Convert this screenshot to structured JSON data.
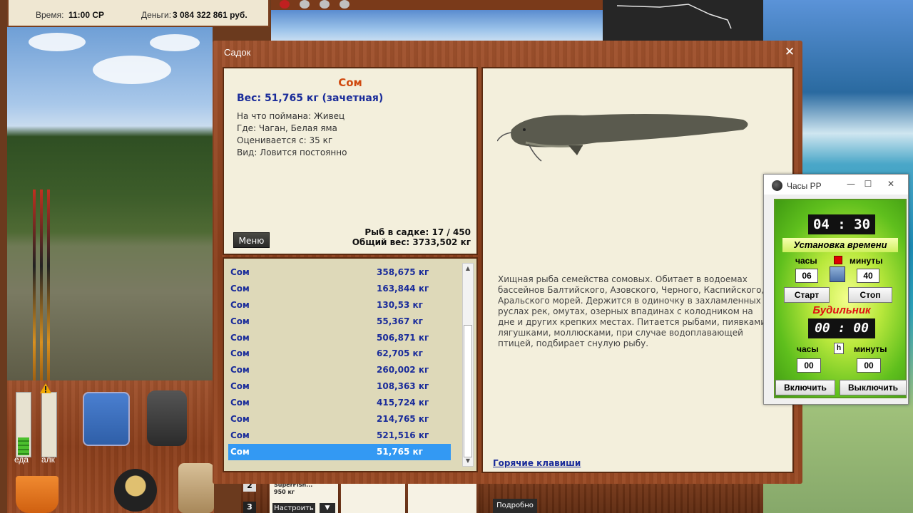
{
  "game_top": {
    "time_label": "Время:",
    "time_value": "11:00 СР",
    "money_label": "Деньги:",
    "money_value": "3 084 322 861 руб."
  },
  "meters": {
    "food_label": "еда",
    "alcohol_label": "алк",
    "food_level_pct": 28,
    "alcohol_level_pct": 0
  },
  "bottom_mid": {
    "row2_label": "2",
    "row3_label": "3",
    "item_name": "SuperFish...",
    "item_weight": "950 кг",
    "configure_button": "Настроить",
    "dropdown_arrow": "▼"
  },
  "bottom_right": {
    "details_button": "Подробно"
  },
  "sadok": {
    "title": "Садок",
    "close_symbol": "✕",
    "fish_name": "Сом",
    "weight_line": "Вес: 51,765 кг (зачетная)",
    "caught_on": "На что поймана: Живец",
    "where": "Где: Чаган, Белая яма",
    "valued_from": "Оценивается с: 35 кг",
    "kind": "Вид: Ловится постоянно",
    "menu_button": "Меню",
    "fish_in_cage": "Рыб в садке: 17 / 450",
    "total_weight": "Общий вес: 3733,502 кг",
    "list": [
      {
        "name": "Сом",
        "weight": "358,675 кг"
      },
      {
        "name": "Сом",
        "weight": "163,844 кг"
      },
      {
        "name": "Сом",
        "weight": "130,53 кг"
      },
      {
        "name": "Сом",
        "weight": "55,367 кг"
      },
      {
        "name": "Сом",
        "weight": "506,871 кг"
      },
      {
        "name": "Сом",
        "weight": "62,705 кг"
      },
      {
        "name": "Сом",
        "weight": "260,002 кг"
      },
      {
        "name": "Сом",
        "weight": "108,363 кг"
      },
      {
        "name": "Сом",
        "weight": "415,724 кг"
      },
      {
        "name": "Сом",
        "weight": "214,765 кг"
      },
      {
        "name": "Сом",
        "weight": "521,516 кг"
      },
      {
        "name": "Сом",
        "weight": "51,765 кг"
      }
    ],
    "selected_index": 11,
    "description": "Хищная рыба семейства сомовых. Обитает в водоемах бассейнов Балтийского, Азовского, Черного, Каспийского, Аральского морей. Держится в одиночку в захламленных руслах рек, омутах, озерных впадинах с колодником на дне и других крепких местах. Питается рыбами, пиявками, лягушками, моллюсками, при случае водоплавающей птицей, подбирает снулую рыбу.",
    "hotkeys_link": "Горячие клавиши"
  },
  "clock": {
    "title": "Часы РР",
    "minimize": "—",
    "maximize": "☐",
    "close": "✕",
    "display_time": "04 : 30",
    "set_time_label": "Установка времени",
    "hours_label": "часы",
    "minutes_label": "минуты",
    "hours_value": "06",
    "minutes_value": "40",
    "start_button": "Старт",
    "stop_button": "Стоп",
    "alarm_label": "Будильник",
    "alarm_display": "00 : 00",
    "alarm_hours_label": "часы",
    "alarm_toggle": "h",
    "alarm_minutes_label": "минуты",
    "alarm_hours_value": "00",
    "alarm_minutes_value": "00",
    "enable_button": "Включить",
    "disable_button": "Выключить"
  }
}
